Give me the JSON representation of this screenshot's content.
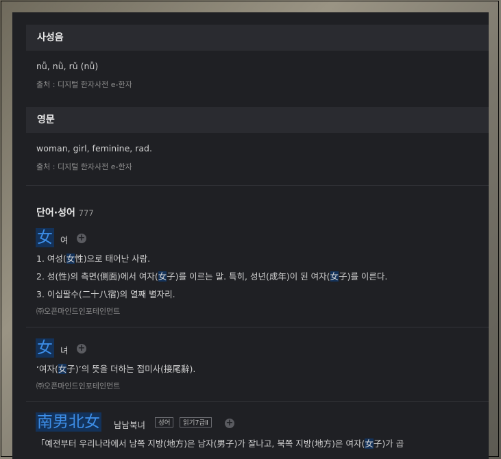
{
  "pron": {
    "header": "사성음",
    "value": "nǚ, nǜ, rǔ (nǚ)",
    "source": "출처 : 디지털 한자사전 e-한자"
  },
  "english": {
    "header": "영문",
    "value": "woman, girl, feminine, rad.",
    "source": "출처 : 디지털 한자사전 e-한자"
  },
  "words": {
    "title": "단어·성어",
    "count": "777",
    "entries": [
      {
        "hanja": "女",
        "reading": "여",
        "meanings": [
          [
            "1. 여성(",
            "女",
            "性)으로 태어난 사람."
          ],
          [
            "2. 성(性)의 측면(側面)에서 여자(",
            "女",
            "子)를 이르는 말. 특히, 성년(成年)이 된 여자(",
            "女",
            "子)를 이른다."
          ],
          [
            "3. 이십팔수(二十八宿)의 열째 별자리."
          ]
        ],
        "source": "㈜오픈마인드인포테인먼트"
      },
      {
        "hanja": "女",
        "reading": "녀",
        "meanings": [
          [
            "‘여자(",
            "女",
            "子)’의 뜻을 더하는 접미사(接尾辭)."
          ]
        ],
        "source": "㈜오픈마인드인포테인먼트"
      },
      {
        "hanja": "南男北女",
        "reading": "남남북녀",
        "tag1": "성어",
        "tag2": "읽기7급Ⅱ",
        "meanings": [
          [
            "「예전부터 우리나라에서 남쪽 지방(地方)은 남자(男子)가 잘나고, 북쪽 지방(地方)은 여자(",
            "女",
            "子)가 곱"
          ]
        ]
      }
    ]
  },
  "plus_symbol": "+"
}
